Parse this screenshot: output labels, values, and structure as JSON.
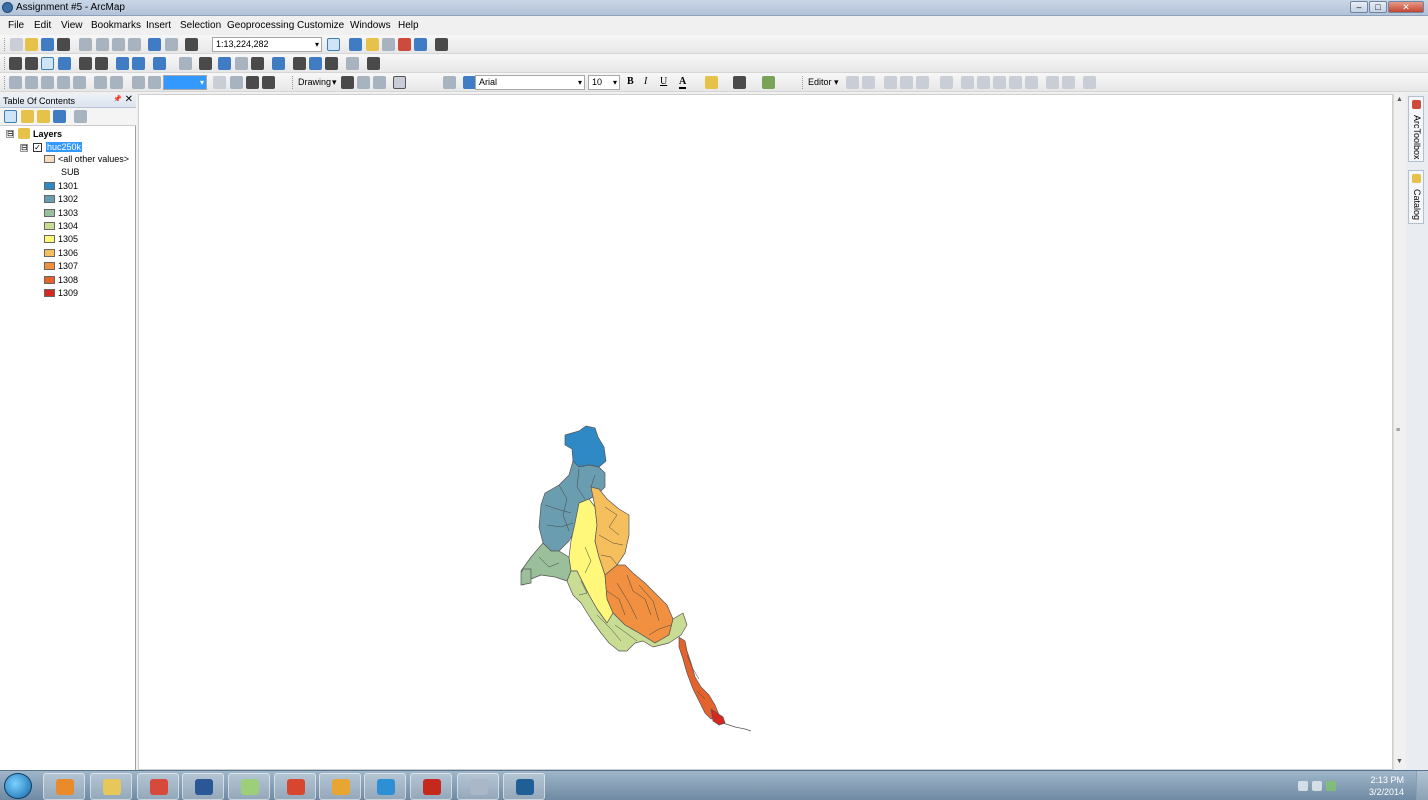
{
  "window": {
    "title": "Assignment #5 - ArcMap",
    "min": "–",
    "max": "□",
    "close": "✕"
  },
  "menubar": [
    "File",
    "Edit",
    "View",
    "Bookmarks",
    "Insert",
    "Selection",
    "Geoprocessing",
    "Customize",
    "Windows",
    "Help"
  ],
  "toolbar": {
    "scale": "1:13,224,282",
    "drawing_label": "Drawing",
    "font_name": "Arial",
    "font_size": "10",
    "bold": "B",
    "italic": "I",
    "underline": "U",
    "font_color_glyph": "A",
    "editor_label": "Editor",
    "dropdown_arrow": "▾",
    "accent_color": "#3399ff"
  },
  "toc": {
    "title": "Table Of Contents",
    "pin": "📌",
    "close": "✕",
    "root": {
      "label": "Layers",
      "expander": "⊟"
    },
    "layer": {
      "label": "huc250k",
      "expander": "⊟",
      "checked": "✓"
    },
    "legend": [
      {
        "label": "<all other values>",
        "color": "#f5dcbc"
      },
      {
        "label": "SUB",
        "color": ""
      },
      {
        "label": "1301",
        "color": "#2f89c5"
      },
      {
        "label": "1302",
        "color": "#6b9db0"
      },
      {
        "label": "1303",
        "color": "#9bbf9a"
      },
      {
        "label": "1304",
        "color": "#c9dc93"
      },
      {
        "label": "1305",
        "color": "#fff87a"
      },
      {
        "label": "1306",
        "color": "#f6bf5d"
      },
      {
        "label": "1307",
        "color": "#f09040"
      },
      {
        "label": "1308",
        "color": "#e4632c"
      },
      {
        "label": "1309",
        "color": "#d42820"
      }
    ]
  },
  "dock": {
    "toolbox": "ArcToolbox",
    "catalog": "Catalog"
  },
  "taskbar": {
    "time": "2:13 PM",
    "date": "3/2/2014",
    "apps": [
      {
        "name": "media-player",
        "color": "#e98b2a"
      },
      {
        "name": "file-explorer",
        "color": "#e8c75a"
      },
      {
        "name": "chrome",
        "color": "#d64a3c"
      },
      {
        "name": "word",
        "color": "#2b5797"
      },
      {
        "name": "map-app",
        "color": "#9dcf7a"
      },
      {
        "name": "c-app",
        "color": "#d8462f"
      },
      {
        "name": "outlook",
        "color": "#e8a531"
      },
      {
        "name": "internet-explorer",
        "color": "#2d8fd6"
      },
      {
        "name": "acrobat",
        "color": "#c5281c"
      },
      {
        "name": "calculator",
        "color": "#a9b7c6"
      },
      {
        "name": "arcmap",
        "color": "#1f5f96"
      }
    ]
  }
}
